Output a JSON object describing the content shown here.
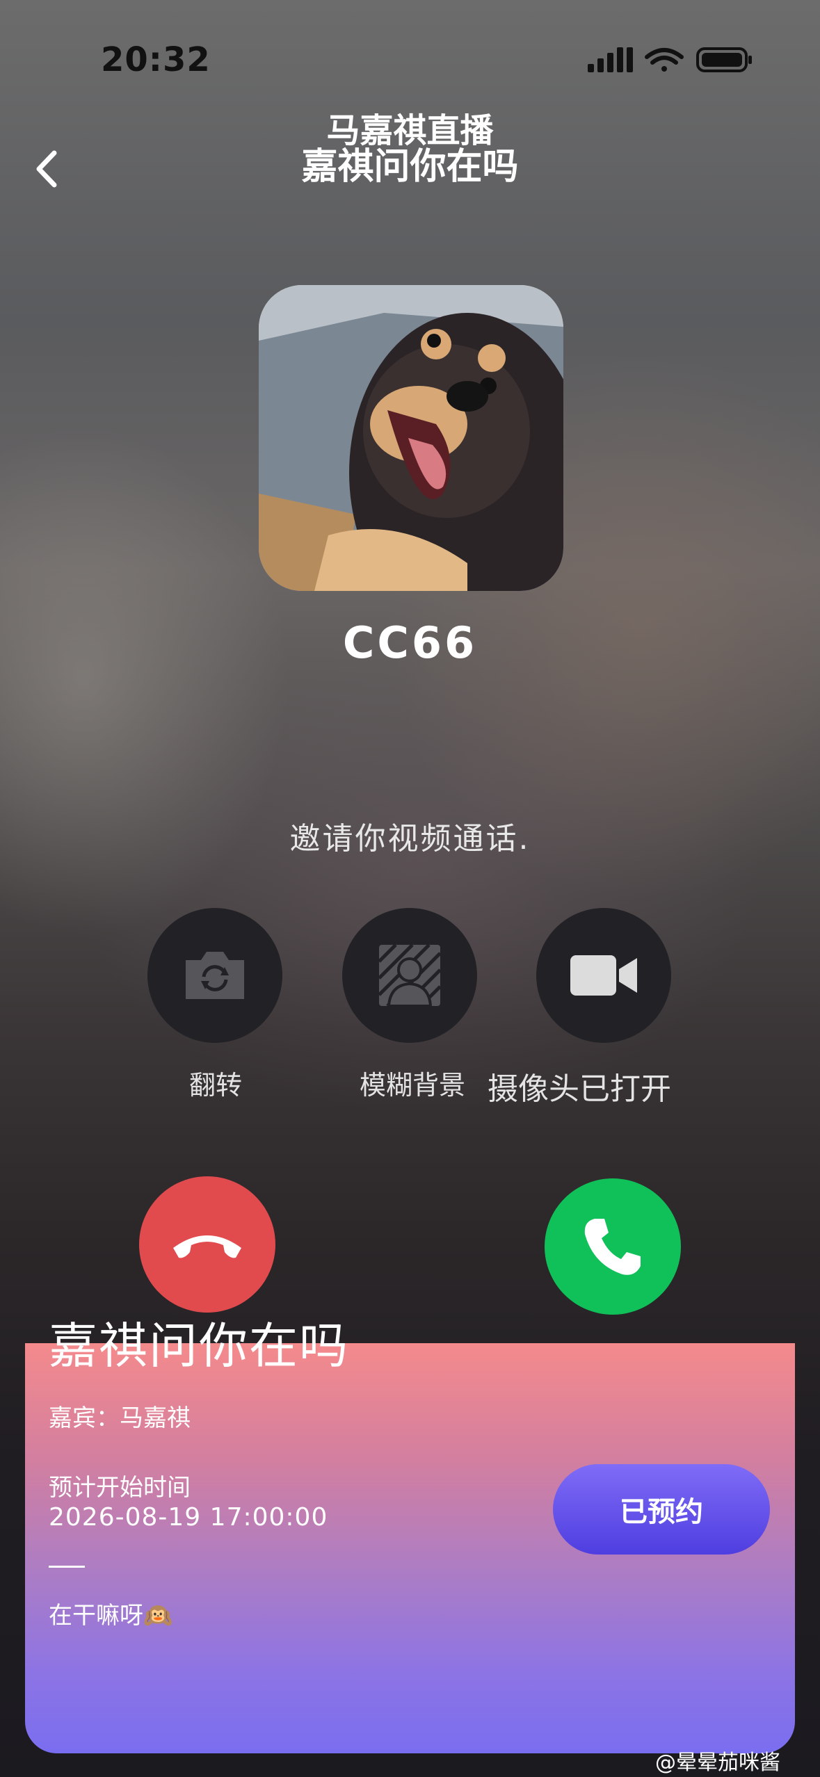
{
  "status_bar": {
    "time": "20:32"
  },
  "header": {
    "title": "马嘉祺直播",
    "subtitle": "嘉祺问你在吗"
  },
  "caller": {
    "name": "CC66",
    "invite_text": "邀请你视频通话."
  },
  "options": [
    {
      "label": "翻转",
      "icon": "camera-flip-icon"
    },
    {
      "label": "模糊背景",
      "icon": "blur-background-icon"
    },
    {
      "label": "摄像头已打开",
      "icon": "video-camera-icon"
    }
  ],
  "call_buttons": {
    "decline_icon": "hang-up-icon",
    "accept_icon": "phone-icon"
  },
  "card": {
    "title": "嘉祺问你在吗",
    "guest": "嘉宾：马嘉祺",
    "start_label": "预计开始时间",
    "start_time": "2026-08-19 17:00:00",
    "note": "在干嘛呀🙉",
    "button": "已预约"
  },
  "watermark": "@晕晕茄咪酱",
  "colors": {
    "decline": "#e24b4e",
    "accept": "#10c15a",
    "button": "#5d4ee8"
  }
}
